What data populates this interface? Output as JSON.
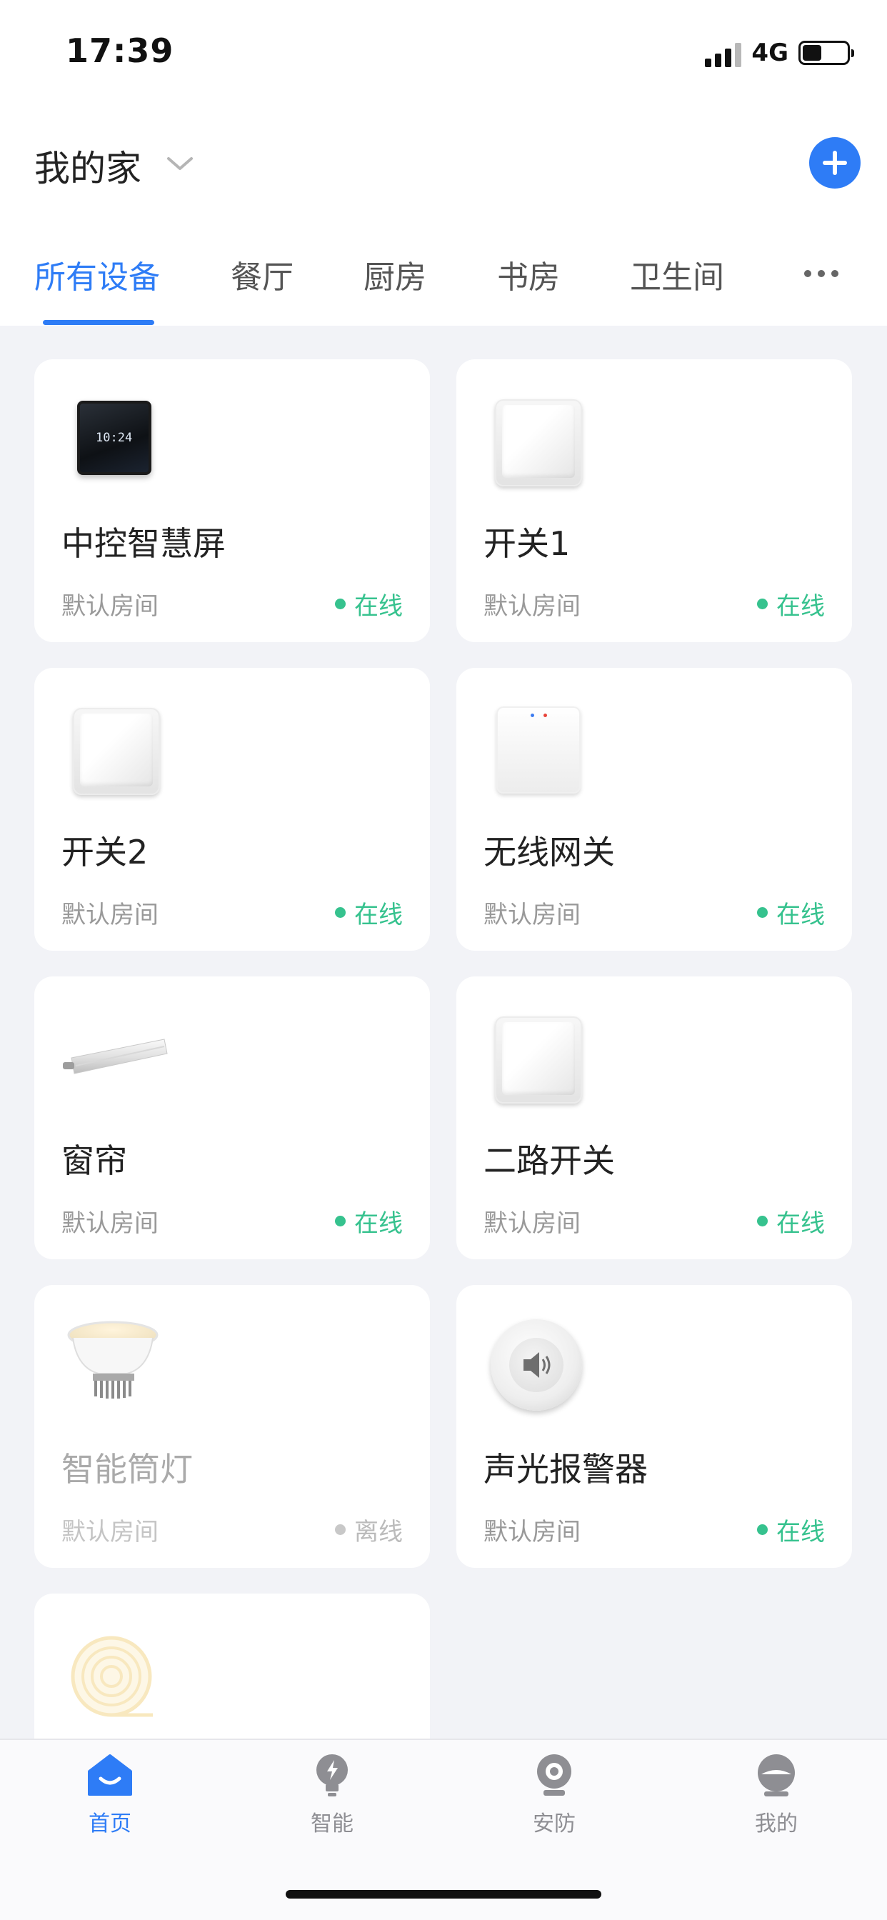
{
  "status_bar": {
    "time": "17:39",
    "network": "4G"
  },
  "header": {
    "home_name": "我的家"
  },
  "tabs": [
    {
      "label": "所有设备",
      "active": true
    },
    {
      "label": "餐厅"
    },
    {
      "label": "厨房"
    },
    {
      "label": "书房"
    },
    {
      "label": "卫生间"
    }
  ],
  "devices": [
    {
      "name": "中控智慧屏",
      "room": "默认房间",
      "status": "在线",
      "screen_time": "10:24"
    },
    {
      "name": "开关1",
      "room": "默认房间",
      "status": "在线"
    },
    {
      "name": "开关2",
      "room": "默认房间",
      "status": "在线"
    },
    {
      "name": "无线网关",
      "room": "默认房间",
      "status": "在线"
    },
    {
      "name": "窗帘",
      "room": "默认房间",
      "status": "在线"
    },
    {
      "name": "二路开关",
      "room": "默认房间",
      "status": "在线"
    },
    {
      "name": "智能筒灯",
      "room": "默认房间",
      "status": "离线"
    },
    {
      "name": "声光报警器",
      "room": "默认房间",
      "status": "在线"
    }
  ],
  "bottom_nav": [
    {
      "label": "首页",
      "icon": "home-icon",
      "active": true
    },
    {
      "label": "智能",
      "icon": "bulb-icon"
    },
    {
      "label": "安防",
      "icon": "camera-icon"
    },
    {
      "label": "我的",
      "icon": "profile-icon"
    }
  ],
  "colors": {
    "accent": "#2e7cf6",
    "online": "#36c28e",
    "offline": "#c8c8c8"
  }
}
